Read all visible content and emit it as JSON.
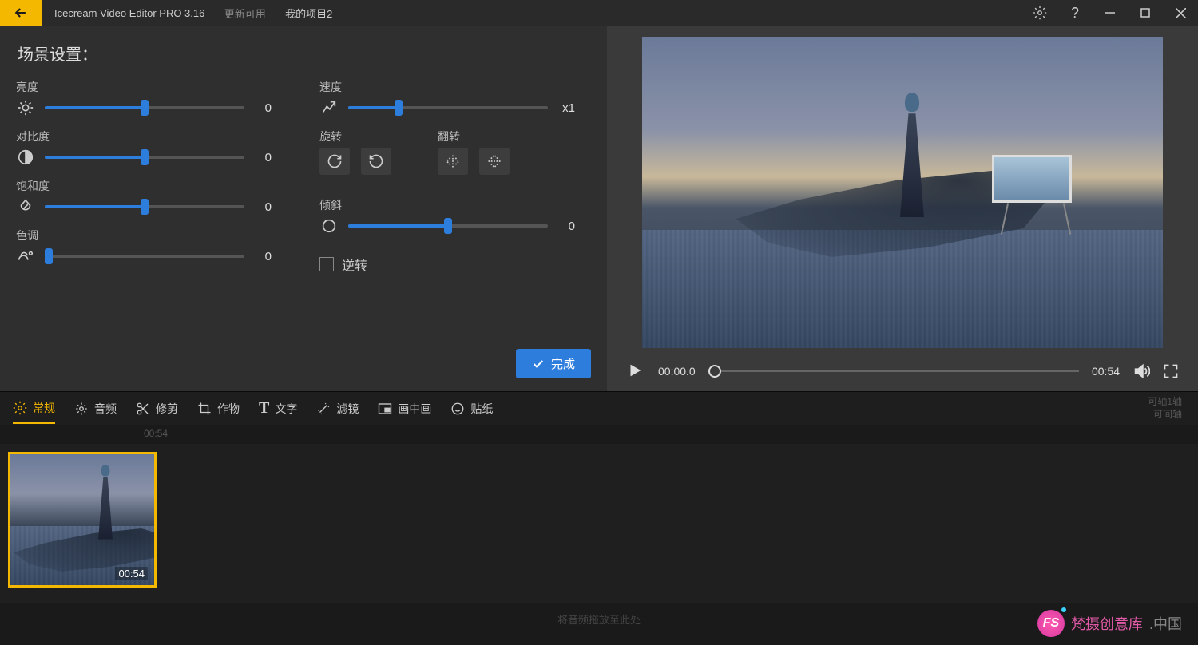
{
  "titlebar": {
    "app": "Icecream Video Editor PRO 3.16",
    "update": "更新可用",
    "project": "我的项目2"
  },
  "panel": {
    "title": "场景设置："
  },
  "controls": {
    "brightness": {
      "label": "亮度",
      "value": "0",
      "pos": 50
    },
    "contrast": {
      "label": "对比度",
      "value": "0",
      "pos": 50
    },
    "saturation": {
      "label": "饱和度",
      "value": "0",
      "pos": 50
    },
    "hue": {
      "label": "色调",
      "value": "0",
      "pos": 2
    },
    "speed": {
      "label": "速度",
      "value": "x1",
      "pos": 25
    },
    "rotate": {
      "label": "旋转"
    },
    "flip": {
      "label": "翻转"
    },
    "tilt": {
      "label": "倾斜",
      "value": "0",
      "pos": 50
    },
    "reverse": {
      "label": "逆转"
    }
  },
  "done_label": "完成",
  "playback": {
    "current": "00:00.0",
    "total": "00:54"
  },
  "tabs": {
    "general": "常规",
    "audio": "音频",
    "trim": "修剪",
    "crop": "作物",
    "text": "文字",
    "filter": "滤镜",
    "pip": "画中画",
    "sticker": "贴纸",
    "right1": "可轴1轴",
    "right2": "可间轴"
  },
  "timeline": {
    "tick": "00:54",
    "clip_duration": "00:54"
  },
  "audio_drop": "将音频拖放至此处",
  "watermark": {
    "badge": "FS",
    "t1": "梵摄创意库",
    "t2": ".中国"
  }
}
